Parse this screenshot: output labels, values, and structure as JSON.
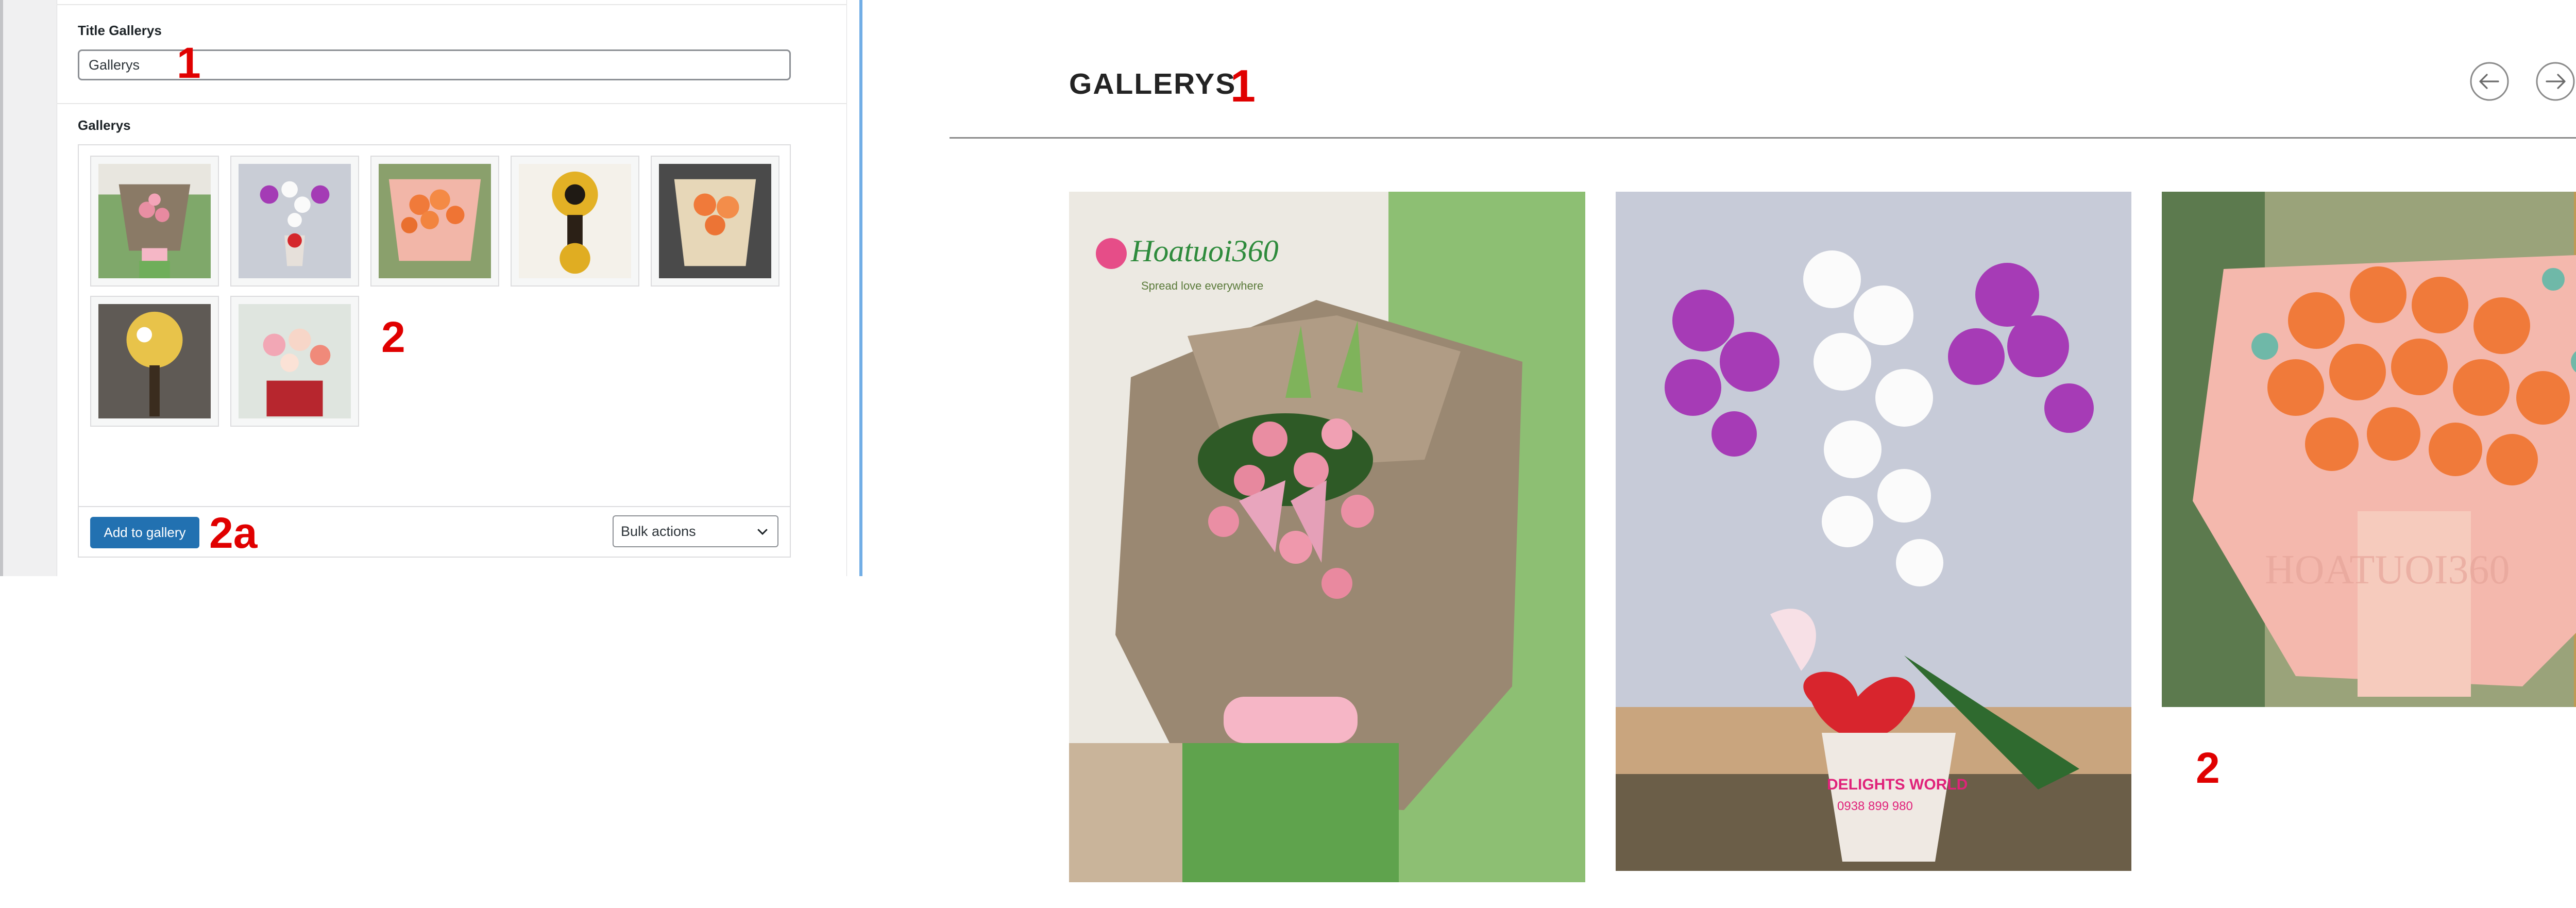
{
  "admin": {
    "title_field": {
      "label": "Title Gallerys",
      "value": "Gallerys"
    },
    "gallery_field": {
      "label": "Gallerys"
    },
    "thumbnails": [
      {
        "icon": "bouquet-pink-lily-image"
      },
      {
        "icon": "orchid-purple-white-image"
      },
      {
        "icon": "bouquet-orange-roses-image"
      },
      {
        "icon": "yellow-flower-stand-image"
      },
      {
        "icon": "bouquet-orange-roses-2-image"
      },
      {
        "icon": "yellow-flower-stand-2-image"
      },
      {
        "icon": "flower-basket-mixed-image"
      }
    ],
    "add_button": "Add to gallery",
    "bulk_select": {
      "selected": "Bulk actions"
    }
  },
  "annotations": {
    "title_marker": "1",
    "gallery_marker": "2",
    "button_marker": "2a",
    "front_title_marker": "1",
    "front_gallery_marker": "2"
  },
  "front": {
    "title": "GALLERYS",
    "prev_icon": "arrow-left-circle-icon",
    "next_icon": "arrow-right-circle-icon",
    "photos": [
      {
        "icon": "bouquet-pink-lily-photo",
        "watermark": "Hoatuoi360",
        "tagline": "Spread love everywhere"
      },
      {
        "icon": "orchid-purple-white-photo",
        "watermark": "DELIGHTS WORLD",
        "phone": "0938 899 980"
      },
      {
        "icon": "bouquet-orange-roses-photo",
        "watermark": "HOATUOI360"
      }
    ]
  },
  "colors": {
    "annotation_red": "#e00000",
    "button_blue": "#2271b1",
    "admin_bg": "#f0f0f1"
  }
}
